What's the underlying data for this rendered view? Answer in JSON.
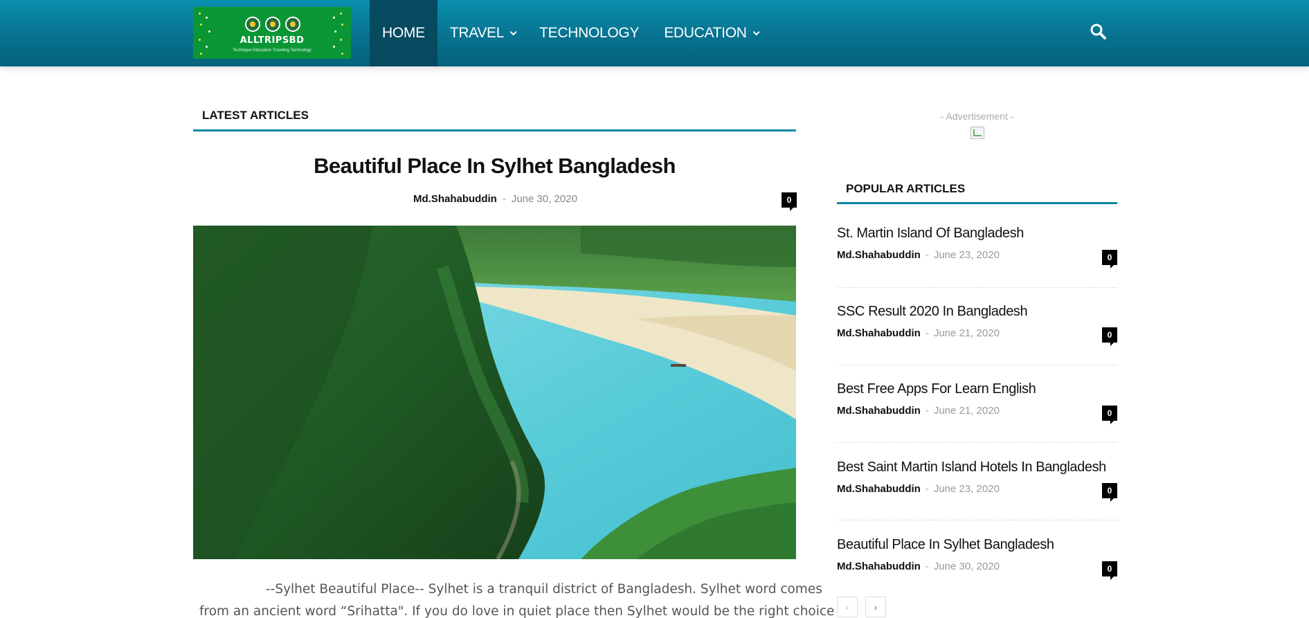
{
  "header": {
    "logo": {
      "name": "ALLTRIPSBD",
      "tagline": "Technique Education Traveling Technology"
    },
    "nav": [
      {
        "label": "HOME",
        "active": true,
        "has_dropdown": false
      },
      {
        "label": "TRAVEL",
        "active": false,
        "has_dropdown": true
      },
      {
        "label": "TECHNOLOGY",
        "active": false,
        "has_dropdown": false
      },
      {
        "label": "EDUCATION",
        "active": false,
        "has_dropdown": true
      }
    ],
    "search_icon": "search-icon"
  },
  "main": {
    "section_title": "LATEST ARTICLES",
    "article": {
      "title": "Beautiful Place In Sylhet Bangladesh",
      "author": "Md.Shahabuddin",
      "separator": "-",
      "date": "June 30, 2020",
      "comments": "0",
      "excerpt_lines": [
        "--Sylhet Beautiful Place--  Sylhet is a tranquil district of Bangladesh. Sylhet word comes",
        "from an ancient word “Srihatta\". If you do love in quiet place then Sylhet would be the right choice"
      ]
    }
  },
  "sidebar": {
    "advertisement_label": "- Advertisement -",
    "section_title": "POPULAR ARTICLES",
    "articles": [
      {
        "title": "St. Martin Island Of Bangladesh",
        "author": "Md.Shahabuddin",
        "date": "June 23, 2020",
        "comments": "0"
      },
      {
        "title": "SSC Result 2020 In Bangladesh",
        "author": "Md.Shahabuddin",
        "date": "June 21, 2020",
        "comments": "0"
      },
      {
        "title": "Best Free Apps For Learn English",
        "author": "Md.Shahabuddin",
        "date": "June 21, 2020",
        "comments": "0"
      },
      {
        "title": "Best Saint Martin Island Hotels In Bangladesh",
        "author": "Md.Shahabuddin",
        "date": "June 23, 2020",
        "comments": "0"
      },
      {
        "title": "Beautiful Place In Sylhet Bangladesh",
        "author": "Md.Shahabuddin",
        "date": "June 30, 2020",
        "comments": "0"
      }
    ],
    "separator": "-",
    "pager": {
      "prev_icon": "chevron-left-icon",
      "next_icon": "chevron-right-icon"
    }
  },
  "colors": {
    "header_top": "#0a8fae",
    "header_bottom": "#06627d",
    "nav_active": "#054a5f",
    "accent_line": "#0a86a6",
    "logo_bg": "#0a9635"
  }
}
